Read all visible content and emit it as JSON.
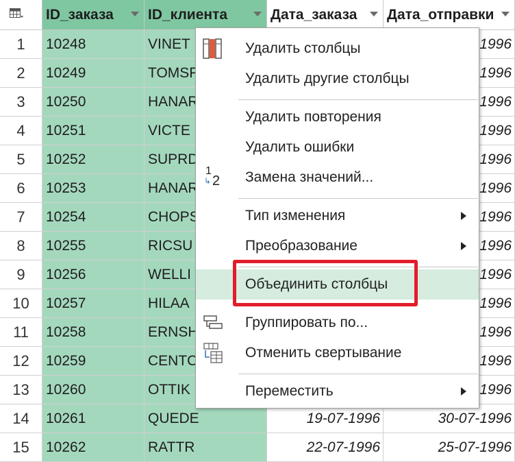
{
  "columns": [
    {
      "label": "ID_заказа"
    },
    {
      "label": "ID_клиента"
    },
    {
      "label": "Дата_заказа"
    },
    {
      "label": "Дата_отправки"
    }
  ],
  "rows": [
    {
      "n": "1",
      "id": "10248",
      "client": "VINET",
      "c3": "",
      "c4": "1996"
    },
    {
      "n": "2",
      "id": "10249",
      "client": "TOMSP",
      "c3": "",
      "c4": "1996"
    },
    {
      "n": "3",
      "id": "10250",
      "client": "HANAR",
      "c3": "",
      "c4": "1996"
    },
    {
      "n": "4",
      "id": "10251",
      "client": "VICTE",
      "c3": "",
      "c4": "1996"
    },
    {
      "n": "5",
      "id": "10252",
      "client": "SUPRD",
      "c3": "",
      "c4": "1996"
    },
    {
      "n": "6",
      "id": "10253",
      "client": "HANAR",
      "c3": "",
      "c4": "1996"
    },
    {
      "n": "7",
      "id": "10254",
      "client": "CHOPS",
      "c3": "",
      "c4": "1996"
    },
    {
      "n": "8",
      "id": "10255",
      "client": "RICSU",
      "c3": "",
      "c4": "1996"
    },
    {
      "n": "9",
      "id": "10256",
      "client": "WELLI",
      "c3": "",
      "c4": "1996"
    },
    {
      "n": "10",
      "id": "10257",
      "client": "HILAA",
      "c3": "",
      "c4": "1996"
    },
    {
      "n": "11",
      "id": "10258",
      "client": "ERNSH",
      "c3": "",
      "c4": "1996"
    },
    {
      "n": "12",
      "id": "10259",
      "client": "CENTC",
      "c3": "",
      "c4": "1996"
    },
    {
      "n": "13",
      "id": "10260",
      "client": "OTTIK",
      "c3": "",
      "c4": "1996"
    },
    {
      "n": "14",
      "id": "10261",
      "client": "QUEDE",
      "c3": "19-07-1996",
      "c4": "30-07-1996"
    },
    {
      "n": "15",
      "id": "10262",
      "client": "RATTR",
      "c3": "22-07-1996",
      "c4": "25-07-1996"
    }
  ],
  "menu": {
    "items": [
      {
        "label": "Удалить столбцы"
      },
      {
        "label": "Удалить другие столбцы"
      },
      {
        "label": "Удалить повторения"
      },
      {
        "label": "Удалить ошибки"
      },
      {
        "label": "Замена значений..."
      },
      {
        "label": "Тип изменения"
      },
      {
        "label": "Преобразование"
      },
      {
        "label": "Объединить столбцы"
      },
      {
        "label": "Группировать по..."
      },
      {
        "label": "Отменить свертывание"
      },
      {
        "label": "Переместить"
      }
    ],
    "replace_icon_top": "1",
    "replace_icon_bottom": "2"
  },
  "colors": {
    "selected_header": "#7fc7a1",
    "selected_cells": "#a4d8bd",
    "hover_item": "#d5ecdf",
    "highlight_box": "#e21d2a"
  }
}
